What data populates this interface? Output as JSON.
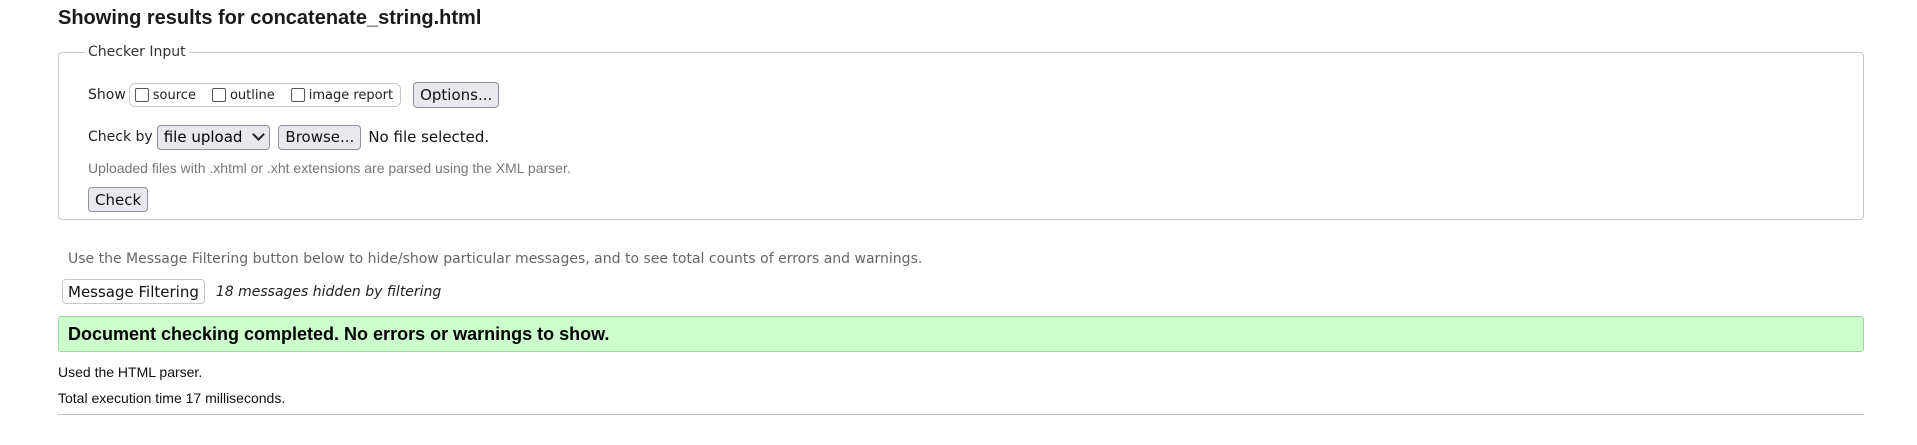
{
  "header": {
    "title": "Showing results for concatenate_string.html"
  },
  "checker_input": {
    "legend": "Checker Input",
    "show_label": "Show",
    "show_options": [
      {
        "label": "source",
        "checked": false
      },
      {
        "label": "outline",
        "checked": false
      },
      {
        "label": "image report",
        "checked": false
      }
    ],
    "options_button": "Options...",
    "check_by_label": "Check by",
    "check_by_value": "file upload",
    "browse_button": "Browse...",
    "file_status": "No file selected.",
    "upload_note": "Uploaded files with .xhtml or .xht extensions are parsed using the XML parser.",
    "check_button": "Check"
  },
  "filtering": {
    "note": "Use the Message Filtering button below to hide/show particular messages, and to see total counts of errors and warnings.",
    "button": "Message Filtering",
    "hidden_count": "18 messages hidden by filtering"
  },
  "result": {
    "message": "Document checking completed. No errors or warnings to show.",
    "color": "#ccffcc"
  },
  "footer": {
    "parser": "Used the HTML parser.",
    "execution_time": "Total execution time 17 milliseconds."
  }
}
